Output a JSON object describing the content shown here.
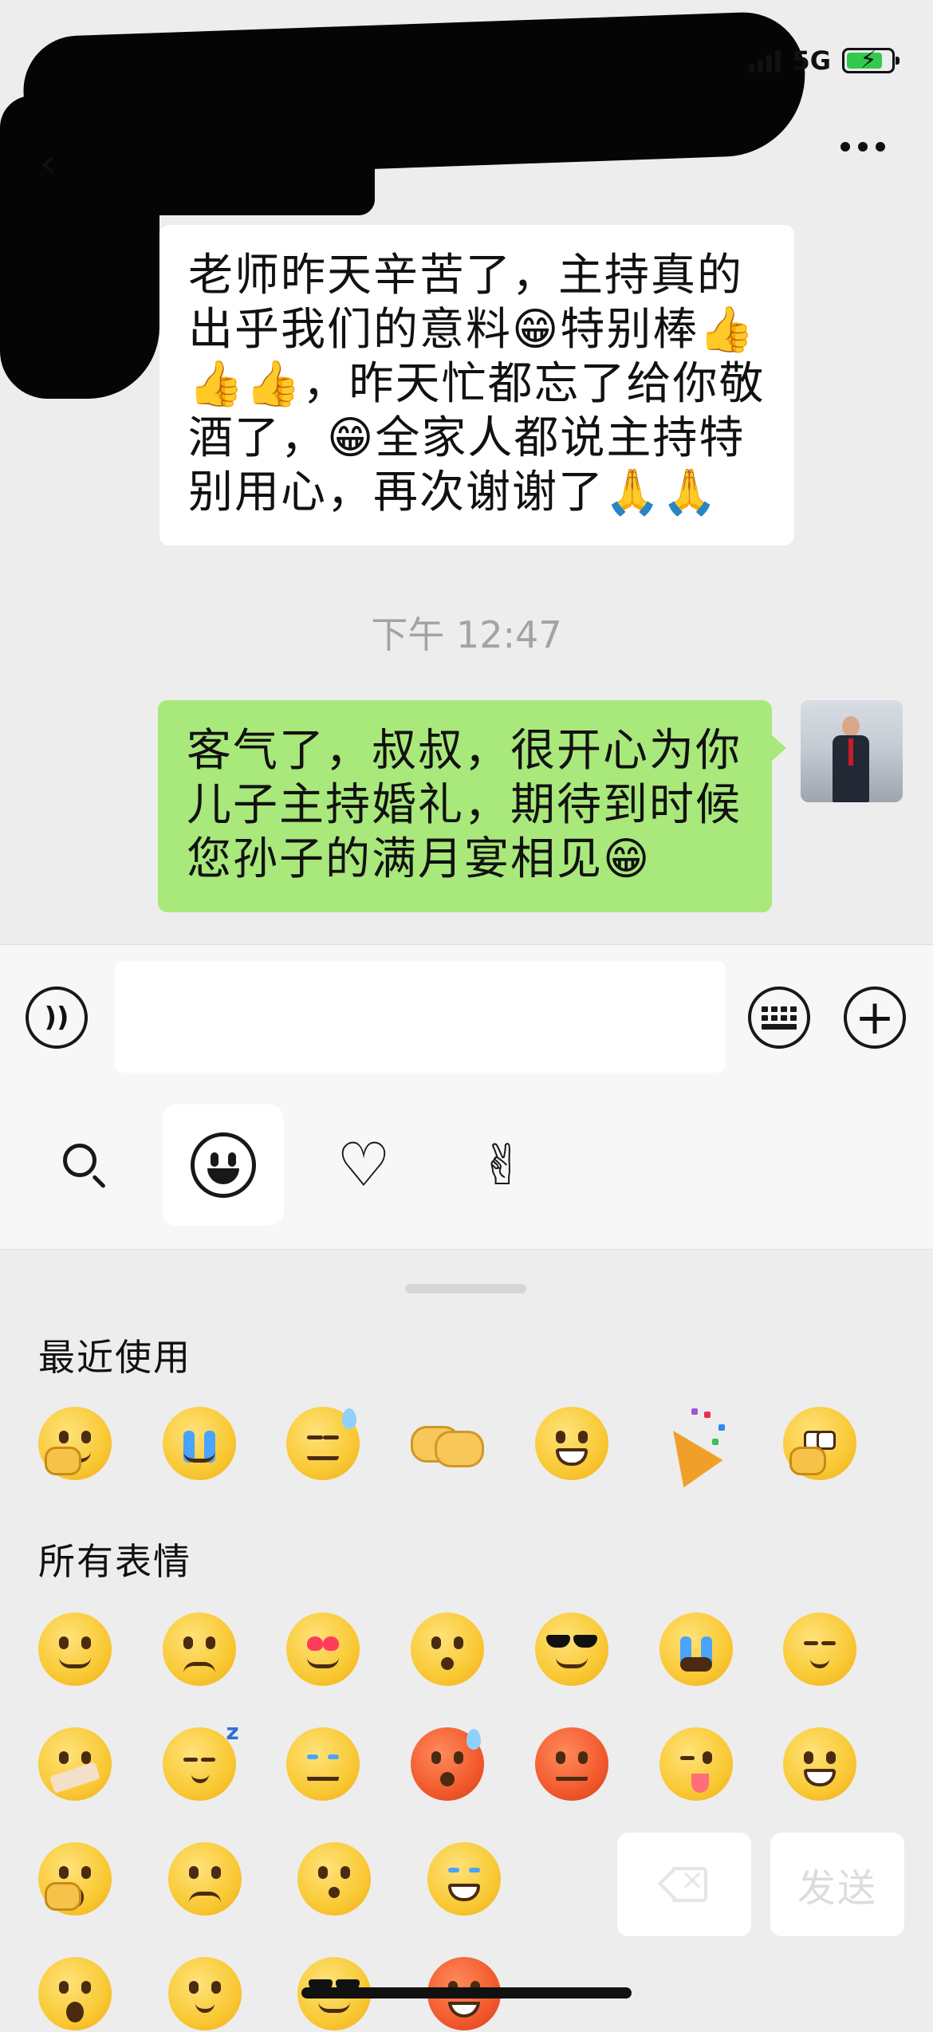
{
  "status_bar": {
    "network": "5G",
    "battery_fill": 0.8
  },
  "messages": {
    "incoming": "老师昨天辛苦了，主持真的出乎我们的意料😁特别棒👍👍👍，昨天忙都忘了给你敬酒了，😁全家人都说主持特别用心，再次谢谢了🙏🙏",
    "timestamp": "下午 12:47",
    "outgoing": "客气了，叔叔，很开心为你儿子主持婚礼，期待到时候您孙子的满月宴相见😁"
  },
  "input_bar": {
    "text_value": ""
  },
  "emoji_tabs": [
    "search",
    "emoji",
    "favorites",
    "stickers"
  ],
  "emoji_panel": {
    "recent_title": "最近使用",
    "recent": [
      "facepalm-smile",
      "cover-face-cry",
      "sweat",
      "handshake",
      "grin",
      "party-popper",
      "thinking-pose"
    ],
    "all_title": "所有表情",
    "all_rows": [
      [
        "smile",
        "worried",
        "heart-eyes",
        "stare",
        "sunglasses",
        "cry",
        "shy"
      ],
      [
        "shush",
        "sleepy",
        "frustrated-cry",
        "sweat-embarrassed",
        "angry",
        "tongue-wink",
        "grin"
      ],
      [
        "surprised-hand",
        "sad",
        "surprised",
        "laugh-cry"
      ],
      [
        "shock",
        "question",
        "cool",
        "angry-vein"
      ]
    ],
    "send_label": "发送"
  },
  "colors": {
    "incoming_bubble": "#ffffff",
    "outgoing_bubble": "#a9e87a",
    "background": "#ededed"
  }
}
